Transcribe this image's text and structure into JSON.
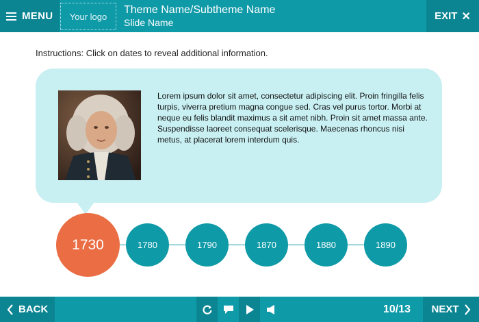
{
  "header": {
    "menu_label": "MENU",
    "logo_text": "Your logo",
    "title": "Theme Name/Subtheme Name",
    "subtitle": "Slide Name",
    "exit_label": "EXIT"
  },
  "content": {
    "instructions": "Instructions: Click on dates to reveal additional information.",
    "body": "Lorem ipsum dolor sit amet, consectetur adipiscing elit. Proin fringilla felis turpis, viverra pretium magna congue sed. Cras vel purus tortor. Morbi at neque eu felis blandit maximus a sit amet nibh. Proin sit amet massa ante. Suspendisse laoreet consequat scelerisque. Maecenas rhoncus nisi metus, at placerat lorem interdum quis."
  },
  "timeline": {
    "active": "1730",
    "dates": [
      "1780",
      "1790",
      "1870",
      "1880",
      "1890"
    ]
  },
  "footer": {
    "back_label": "BACK",
    "next_label": "NEXT",
    "page_counter": "10/13",
    "controls": [
      "replay-icon",
      "comment-icon",
      "play-icon",
      "volume-icon"
    ]
  },
  "colors": {
    "teal": "#0f9aa8",
    "teal_dark": "#0c8593",
    "bubble": "#c8eff2",
    "active_node": "#ea6d43"
  }
}
